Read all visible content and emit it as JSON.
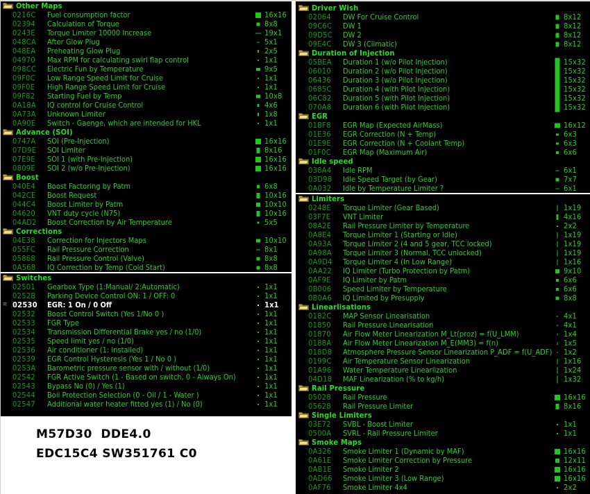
{
  "footer": {
    "line1": "M57D30  DDE4.0",
    "line2": "EDC15C4 SW351761 C0"
  },
  "icons": {
    "folder": "folder-icon",
    "selected_marker": "≡"
  },
  "colors": {
    "background": "#000000",
    "group_label": "#25e025",
    "address": "#1b9c1b",
    "map_name": "#2ecc2e",
    "selected_row": "#ffffff",
    "separator": "#ffffff",
    "folder_icon": "#d8b84a",
    "footer_text": "#000000"
  },
  "left_column": {
    "panels": [
      {
        "groups": [
          {
            "label": "Other Maps",
            "rows": [
              {
                "addr": "0216C",
                "name": "Fuel consumption factor",
                "size": "16x16",
                "w": 8,
                "h": 8
              },
              {
                "addr": "02394",
                "name": "Calculation of Torque",
                "size": "8x8",
                "w": 5,
                "h": 5
              },
              {
                "addr": "0243E",
                "name": "Torque Limiter 10000 Increase",
                "size": "19x1",
                "w": 9,
                "h": 1
              },
              {
                "addr": "048CA",
                "name": "After Glow Plug",
                "size": "5x1",
                "w": 4,
                "h": 1
              },
              {
                "addr": "048EA",
                "name": "Preheating Glow Plug",
                "size": "2x5",
                "w": 2,
                "h": 4
              },
              {
                "addr": "04970",
                "name": "Max RPM for calculating swirl flap control",
                "size": "1x1",
                "w": 2,
                "h": 2
              },
              {
                "addr": "098CC",
                "name": "Electric Fun by Temperature",
                "size": "9x5",
                "w": 6,
                "h": 4
              },
              {
                "addr": "09F0C",
                "name": "Low Range Speed Limit for Cruise",
                "size": "1x1",
                "w": 2,
                "h": 2
              },
              {
                "addr": "09F0E",
                "name": "High Range Speed Limit for Cruise",
                "size": "1x1",
                "w": 2,
                "h": 2
              },
              {
                "addr": "09F82",
                "name": "Starting Fuel by Temp",
                "size": "10x8",
                "w": 6,
                "h": 5
              },
              {
                "addr": "0A18A",
                "name": "IQ control for Cruise Control",
                "size": "4x6",
                "w": 3,
                "h": 4
              },
              {
                "addr": "0A73A",
                "name": "Unknown Limiter",
                "size": "1x8",
                "w": 2,
                "h": 5
              },
              {
                "addr": "0A90E",
                "name": "Switch - Gaenge, which are intended for HKL",
                "size": "1x1",
                "w": 2,
                "h": 2
              }
            ]
          },
          {
            "label": "Advance (SOI)",
            "rows": [
              {
                "addr": "0747A",
                "name": "SOI (Pre-Injection)",
                "size": "16x16",
                "w": 8,
                "h": 8
              },
              {
                "addr": "07D9E",
                "name": "SOI Limiter",
                "size": "8x16",
                "w": 5,
                "h": 8
              },
              {
                "addr": "07E9E",
                "name": "SOI 1 (with Pre-Injection)",
                "size": "16x16",
                "w": 8,
                "h": 8
              },
              {
                "addr": "0809E",
                "name": "SOI 2 (w/o Pre-Injection)",
                "size": "16x16",
                "w": 8,
                "h": 8
              }
            ]
          },
          {
            "label": "Boost",
            "rows": [
              {
                "addr": "040E4",
                "name": "Boost Factoring by Patm",
                "size": "6x8",
                "w": 4,
                "h": 5
              },
              {
                "addr": "042CE",
                "name": "Boost Request",
                "size": "10x16",
                "w": 5,
                "h": 8
              },
              {
                "addr": "044C4",
                "name": "Boost Limiter by Patm",
                "size": "10x10",
                "w": 6,
                "h": 6
              },
              {
                "addr": "04620",
                "name": "VNT duty cycle (N75)",
                "size": "10x16",
                "w": 5,
                "h": 8
              },
              {
                "addr": "04AD2",
                "name": "Boost Correction by Air Temperature",
                "size": "5x5",
                "w": 3,
                "h": 3
              }
            ]
          },
          {
            "label": "Corrections",
            "rows": [
              {
                "addr": "04E38",
                "name": "Correction for Injectors Maps",
                "size": "10x10",
                "w": 6,
                "h": 5
              },
              {
                "addr": "055FC",
                "name": "Rail Pressure Correction",
                "size": "8x1",
                "w": 6,
                "h": 1
              },
              {
                "addr": "05868",
                "name": "Rail Pressure Control (Valve)",
                "size": "8x8",
                "w": 5,
                "h": 5
              },
              {
                "addr": "0A568",
                "name": "IQ Correction by Temp (Cold Start)",
                "size": "8x8",
                "w": 5,
                "h": 5
              }
            ]
          }
        ]
      },
      {
        "groups": [
          {
            "label": "Switches",
            "rows": [
              {
                "addr": "02501",
                "name": "Gearbox Type (1:Manual/ 2:Automatic)",
                "size": "1x1",
                "w": 2,
                "h": 2
              },
              {
                "addr": "0252B",
                "name": "Parking Device Control ON: 1 / OFF: 0",
                "size": "1x1",
                "w": 2,
                "h": 2
              },
              {
                "addr": "02530",
                "name": "EGR: 1 On / 0 Off",
                "size": "1x1",
                "w": 2,
                "h": 2,
                "selected": true
              },
              {
                "addr": "02532",
                "name": "Boost Control Switch (Yes 1/No 0 )",
                "size": "1x1",
                "w": 2,
                "h": 2
              },
              {
                "addr": "02533",
                "name": "FGR Type",
                "size": "1x1",
                "w": 2,
                "h": 2
              },
              {
                "addr": "02534",
                "name": "Transmission Differential Brake yes / no (1/0)",
                "size": "1x1",
                "w": 2,
                "h": 2
              },
              {
                "addr": "02535",
                "name": "Speed limit yes / no (1/0)",
                "size": "1x1",
                "w": 2,
                "h": 2
              },
              {
                "addr": "02536",
                "name": "Air conditioner (1: installed)",
                "size": "1x1",
                "w": 2,
                "h": 2
              },
              {
                "addr": "02539",
                "name": "EGR Control Hysteresis (Yes 1 / No 0 )",
                "size": "1x1",
                "w": 2,
                "h": 2
              },
              {
                "addr": "0253A",
                "name": "Barometric pressure sensor with / without (1/0)",
                "size": "1x1",
                "w": 2,
                "h": 2
              },
              {
                "addr": "02542",
                "name": "FGR Active Switch (1 - Based on switch, 0 - Always On)",
                "size": "1x1",
                "w": 2,
                "h": 2
              },
              {
                "addr": "02543",
                "name": "Bypass No (0) / Yes (1)",
                "size": "1x1",
                "w": 2,
                "h": 2
              },
              {
                "addr": "02544",
                "name": "Boil Protection Selection (0 - Oil / 1 - Water )",
                "size": "1x1",
                "w": 2,
                "h": 2
              },
              {
                "addr": "02547",
                "name": "Additional water heater fitted yes (1) / No (0)",
                "size": "1x1",
                "w": 2,
                "h": 2
              }
            ]
          }
        ]
      }
    ]
  },
  "right_column": {
    "panels": [
      {
        "groups": [
          {
            "label": "Driver Wish",
            "rows": [
              {
                "addr": "02064",
                "name": "DW For Cruise Control",
                "size": "8x12",
                "w": 5,
                "h": 7
              },
              {
                "addr": "09C6C",
                "name": "DW 1",
                "size": "8x12",
                "w": 5,
                "h": 7
              },
              {
                "addr": "09D5C",
                "name": "DW 2",
                "size": "8x12",
                "w": 5,
                "h": 7
              },
              {
                "addr": "09E4C",
                "name": "DW 3 (Climatic)",
                "size": "8x12",
                "w": 5,
                "h": 7
              }
            ]
          },
          {
            "label": "Duration of Injection",
            "rows": [
              {
                "addr": "05BEA",
                "name": "Duration 1 (w/o Pilot Injection)",
                "size": "15x32",
                "w": 7,
                "h": 13
              },
              {
                "addr": "06010",
                "name": "Duration 2 (w/o Pilot Injection)",
                "size": "15x32",
                "w": 7,
                "h": 13
              },
              {
                "addr": "06436",
                "name": "Duration 3 (w/o Pilot Injection)",
                "size": "15x32",
                "w": 7,
                "h": 13
              },
              {
                "addr": "0685C",
                "name": "Duration 4 (with Pilot Injection)",
                "size": "15x32",
                "w": 7,
                "h": 13
              },
              {
                "addr": "06C82",
                "name": "Duration 5 (with Pilot Injection)",
                "size": "15x32",
                "w": 7,
                "h": 13
              },
              {
                "addr": "070A8",
                "name": "Duration 6 (with Pilot Injection)",
                "size": "15x32",
                "w": 7,
                "h": 13
              }
            ]
          },
          {
            "label": "EGR",
            "rows": [
              {
                "addr": "01BF8",
                "name": "EGR Map (Expected AirMass)",
                "size": "16x12",
                "w": 8,
                "h": 7
              },
              {
                "addr": "01E36",
                "name": "EGR Correction (N + Temp)",
                "size": "6x3",
                "w": 4,
                "h": 3
              },
              {
                "addr": "01E9E",
                "name": "EGR Correction (N + Coolant Temp)",
                "size": "6x3",
                "w": 4,
                "h": 3
              },
              {
                "addr": "01F0C",
                "name": "EGR Map (Maximum Air)",
                "size": "6x6",
                "w": 4,
                "h": 4
              }
            ]
          },
          {
            "label": "Idle speed",
            "rows": [
              {
                "addr": "038A4",
                "name": "Idle RPM",
                "size": "6x1",
                "w": 5,
                "h": 1
              },
              {
                "addr": "03D98",
                "name": "Idle Speed Target (by Gear)",
                "size": "7x7",
                "w": 5,
                "h": 5
              },
              {
                "addr": "0A032",
                "name": "Idle by Temperature Limiter ?",
                "size": "6x1",
                "w": 5,
                "h": 1
              }
            ]
          }
        ]
      },
      {
        "groups": [
          {
            "label": "Limiters",
            "rows": [
              {
                "addr": "0248E",
                "name": "Torque Limiter (Gear Based)",
                "size": "1x19",
                "w": 1,
                "h": 9
              },
              {
                "addr": "03F7E",
                "name": "VNT Limiter",
                "size": "4x16",
                "w": 3,
                "h": 8
              },
              {
                "addr": "08A2E",
                "name": "Rail Pressure Limiter by Temperature",
                "size": "2x2",
                "w": 2,
                "h": 2
              },
              {
                "addr": "0A8E4",
                "name": "Torque Limiter 1 (Starting or Idle)",
                "size": "1x19",
                "w": 1,
                "h": 9
              },
              {
                "addr": "0A93A",
                "name": "Torque Limiter 2 (4 and 5 gear, TCC locked)",
                "size": "1x19",
                "w": 1,
                "h": 9
              },
              {
                "addr": "0A98A",
                "name": "Torque Limiter 3 (Normal, TCC unlocked)",
                "size": "1x19",
                "w": 1,
                "h": 9
              },
              {
                "addr": "0A9D4",
                "name": "Torque Limiter 4 (In Low Range)",
                "size": "1x16",
                "w": 1,
                "h": 8
              },
              {
                "addr": "0AA22",
                "name": "IQ Limiter (Turbo Protection by Patm)",
                "size": "9x10",
                "w": 6,
                "h": 6
              },
              {
                "addr": "0AF9E",
                "name": "IQ Limiter by Patm",
                "size": "6x6",
                "w": 4,
                "h": 4
              },
              {
                "addr": "0B006",
                "name": "Speed Limiter by Temperature",
                "size": "6x6",
                "w": 4,
                "h": 4
              },
              {
                "addr": "0B0A6",
                "name": "IQ Limited by Presupply",
                "size": "8x8",
                "w": 5,
                "h": 5
              }
            ]
          },
          {
            "label": "Linearlisations",
            "rows": [
              {
                "addr": "0182C",
                "name": "MAP Sensor Linearisation",
                "size": "4x1",
                "w": 3,
                "h": 1
              },
              {
                "addr": "01850",
                "name": "Rail Pressure Linearisation",
                "size": "4x1",
                "w": 3,
                "h": 1
              },
              {
                "addr": "01870",
                "name": "Air Flow Meter Linearization M_Lt(proz) = f(U_LMM)",
                "size": "1x4",
                "w": 1,
                "h": 3
              },
              {
                "addr": "0188A",
                "name": "Air Flow Meter Linearization M_E(MM3) = f(n)",
                "size": "1x5",
                "w": 1,
                "h": 4
              },
              {
                "addr": "018D8",
                "name": "Atmosphere Pressure Sensor Linearization P_ADF = f(U_ADF)",
                "size": "1x2",
                "w": 1,
                "h": 2
              },
              {
                "addr": "0199C",
                "name": "Air Temperature Sensor Linearization",
                "size": "1x16",
                "w": 1,
                "h": 8
              },
              {
                "addr": "01A96",
                "name": "Water Temperature Linearlization",
                "size": "1x24",
                "w": 1,
                "h": 10
              },
              {
                "addr": "04D18",
                "name": "MAF Linearization (% to kg/h)",
                "size": "1x32",
                "w": 1,
                "h": 11
              }
            ]
          },
          {
            "label": "Rail Pressure",
            "rows": [
              {
                "addr": "05028",
                "name": "Rail Pressure",
                "size": "16x16",
                "w": 8,
                "h": 8
              },
              {
                "addr": "05628",
                "name": "Rail Pressure Limiter",
                "size": "8x16",
                "w": 5,
                "h": 8
              }
            ]
          },
          {
            "label": "Single Limiters",
            "rows": [
              {
                "addr": "03E72",
                "name": "SVBL - Boost Limiter",
                "size": "1x1",
                "w": 2,
                "h": 2
              },
              {
                "addr": "0500A",
                "name": "SVRL - Rail Pressure Limiter",
                "size": "1x1",
                "w": 2,
                "h": 2
              }
            ]
          },
          {
            "label": "Smoke Maps",
            "rows": [
              {
                "addr": "0A326",
                "name": "Smoke Limiter 1 (Dynamic by MAF)",
                "size": "16x16",
                "w": 8,
                "h": 8
              },
              {
                "addr": "0A61E",
                "name": "Smoke Limiter Correction by Pressure",
                "size": "12x11",
                "w": 6,
                "h": 6
              },
              {
                "addr": "0AB1E",
                "name": "Smoke Limiter 2",
                "size": "16x16",
                "w": 8,
                "h": 8
              },
              {
                "addr": "0AD66",
                "name": "Smoke Limiter 3 (Low Range)",
                "size": "16x16",
                "w": 8,
                "h": 8
              },
              {
                "addr": "0AF76",
                "name": "Smoke Limiter 4x4",
                "size": "2x2",
                "w": 2,
                "h": 2
              }
            ]
          }
        ]
      }
    ]
  }
}
